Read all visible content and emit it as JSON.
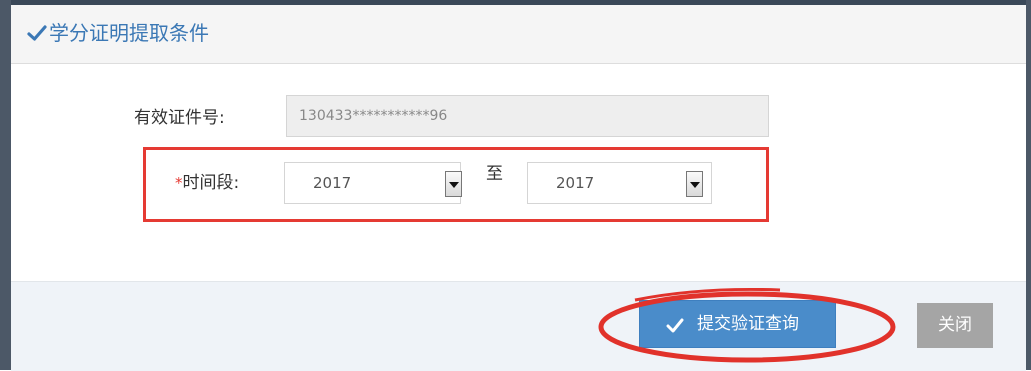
{
  "dialog": {
    "title": "学分证明提取条件",
    "title_icon": "check-icon"
  },
  "form": {
    "id_label": "有效证件号:",
    "id_value": "130433***********96",
    "period_required_mark": "*",
    "period_label": "时间段:",
    "period_from": "2017",
    "period_to_label": "至",
    "period_to": "2017"
  },
  "footer": {
    "submit_label": "提交验证查询",
    "submit_icon": "check-icon",
    "close_label": "关闭"
  },
  "colors": {
    "title": "#3b78b5",
    "highlight": "#e53a33",
    "submit_bg": "#4a8cca",
    "close_bg": "#a5a5a5"
  }
}
